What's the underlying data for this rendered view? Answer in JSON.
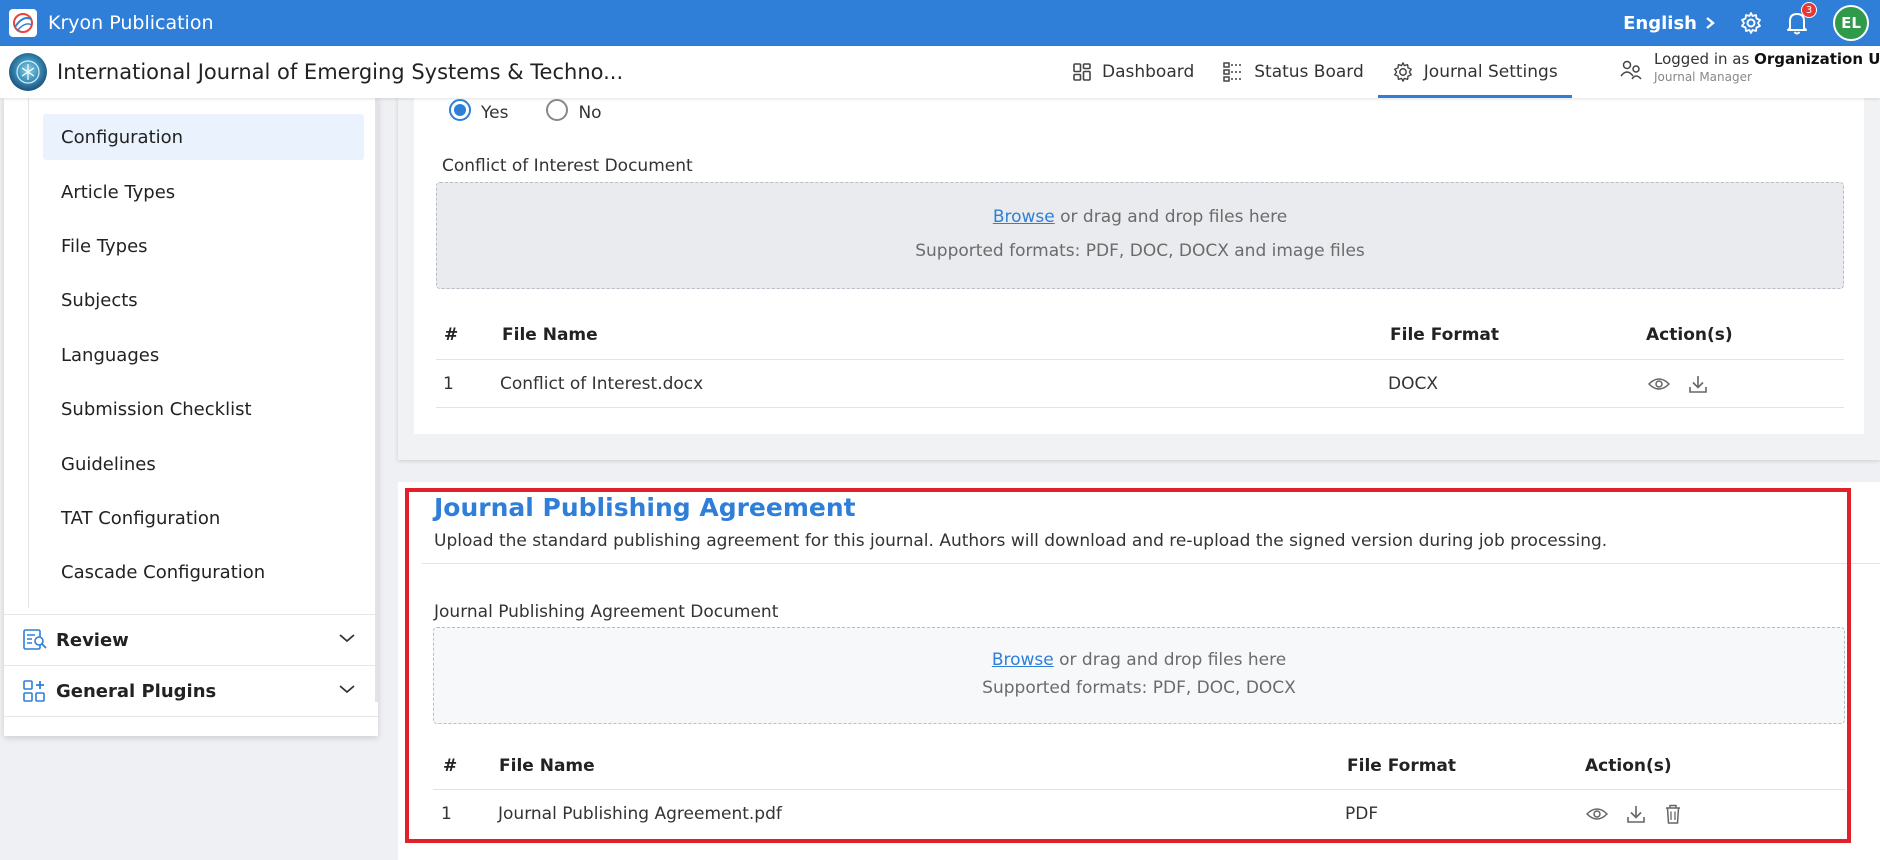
{
  "topbar": {
    "app_title": "Kryon Publication",
    "language": "English",
    "notification_count": "3",
    "avatar_initials": "EL",
    "brand_color": "#2f7fd8"
  },
  "subheader": {
    "journal_title": "International Journal of Emerging Systems & Techno...",
    "nav": [
      {
        "label": "Dashboard",
        "icon": "grid-icon"
      },
      {
        "label": "Status Board",
        "icon": "kanban-icon"
      },
      {
        "label": "Journal Settings",
        "icon": "gear-icon",
        "active": true
      }
    ],
    "user": {
      "prefix": "Logged in as ",
      "name": "Organization User",
      "role": "Journal Manager"
    }
  },
  "sidebar": {
    "items": [
      {
        "label": "Configuration",
        "active": true
      },
      {
        "label": "Article Types"
      },
      {
        "label": "File Types"
      },
      {
        "label": "Subjects"
      },
      {
        "label": "Languages"
      },
      {
        "label": "Submission Checklist"
      },
      {
        "label": "Guidelines"
      },
      {
        "label": "TAT Configuration"
      },
      {
        "label": "Cascade Configuration"
      }
    ],
    "groups": [
      {
        "label": "Review",
        "icon": "review-doc-icon"
      },
      {
        "label": "General Plugins",
        "icon": "plugins-grid-icon"
      }
    ]
  },
  "coi": {
    "radio_yes": "Yes",
    "radio_no": "No",
    "selected": "Yes",
    "document_label": "Conflict of Interest Document",
    "dropzone": {
      "browse": "Browse",
      "rest": " or drag and drop files here",
      "formats": "Supported formats: PDF, DOC, DOCX and image files"
    },
    "table": {
      "headers": [
        "#",
        "File Name",
        "File Format",
        "Action(s)"
      ],
      "rows": [
        {
          "num": "1",
          "name": "Conflict of Interest.docx",
          "format": "DOCX"
        }
      ]
    }
  },
  "jpa": {
    "title": "Journal Publishing Agreement",
    "description": "Upload the standard publishing agreement for this journal. Authors will download and re-upload the signed version during job processing.",
    "document_label": "Journal Publishing Agreement Document",
    "dropzone": {
      "browse": "Browse",
      "rest": " or drag and drop files here",
      "formats": "Supported formats: PDF, DOC, DOCX"
    },
    "table": {
      "headers": [
        "#",
        "File Name",
        "File Format",
        "Action(s)"
      ],
      "rows": [
        {
          "num": "1",
          "name": "Journal Publishing Agreement.pdf",
          "format": "PDF"
        }
      ]
    },
    "highlight_color": "#e0202a"
  }
}
